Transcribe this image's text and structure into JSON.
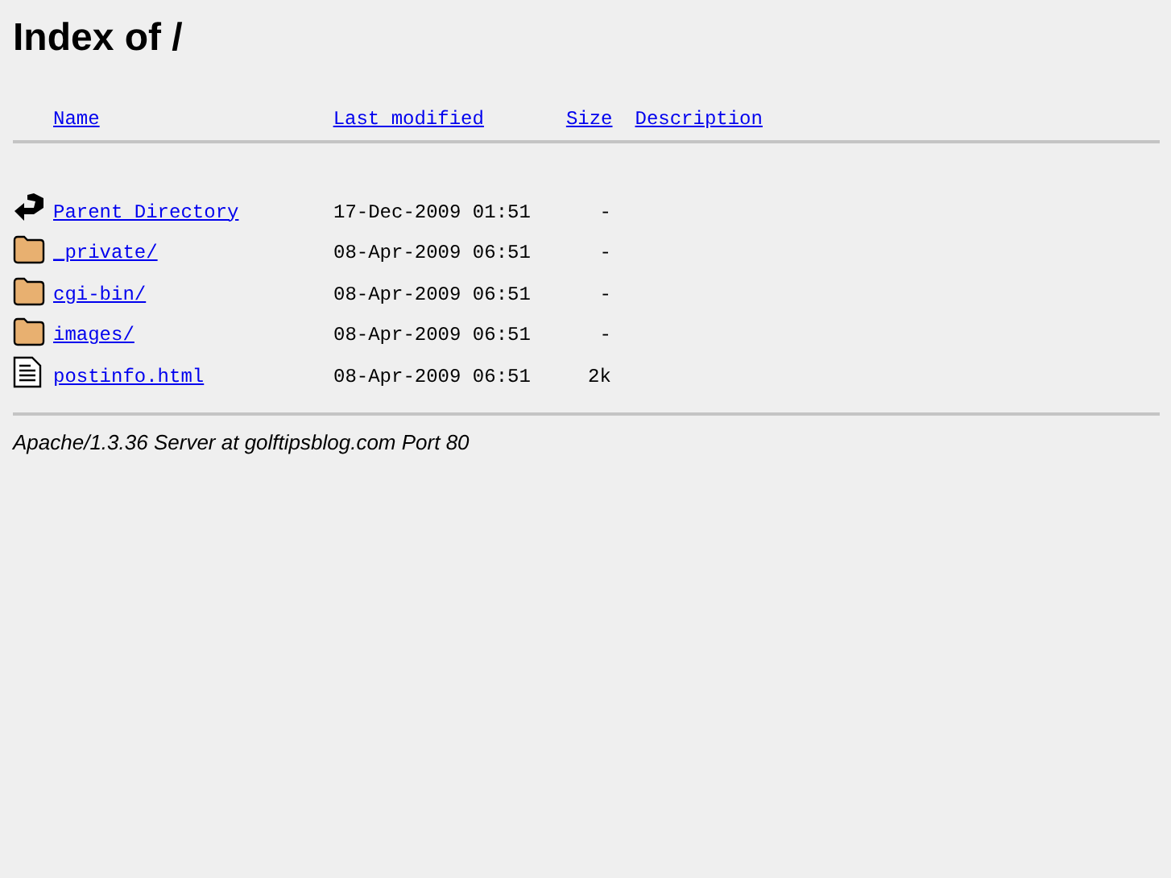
{
  "title": "Index of /",
  "columns": [
    "Name",
    "Last modified",
    "Size",
    "Description"
  ],
  "rows": [
    {
      "kind": "parent",
      "name": "Parent Directory",
      "modified": "17-Dec-2009 01:51",
      "size": "-"
    },
    {
      "kind": "folder",
      "name": "_private/",
      "modified": "08-Apr-2009 06:51",
      "size": "-"
    },
    {
      "kind": "folder",
      "name": "cgi-bin/",
      "modified": "08-Apr-2009 06:51",
      "size": "-"
    },
    {
      "kind": "folder",
      "name": "images/",
      "modified": "08-Apr-2009 06:51",
      "size": "-"
    },
    {
      "kind": "file",
      "name": "postinfo.html",
      "modified": "08-Apr-2009 06:51",
      "size": "2k"
    }
  ],
  "footer": "Apache/1.3.36 Server at golftipsblog.com Port 80"
}
